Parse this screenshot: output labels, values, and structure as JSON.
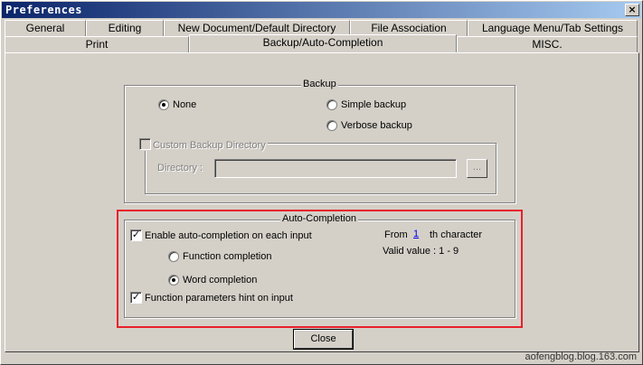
{
  "window": {
    "title": "Preferences"
  },
  "tabs_row1": [
    "General",
    "Editing",
    "New Document/Default Directory",
    "File Association",
    "Language Menu/Tab Settings"
  ],
  "tabs_row2": [
    "Print",
    "Backup/Auto-Completion",
    "MISC."
  ],
  "active_tab": "Backup/Auto-Completion",
  "backup": {
    "title": "Backup",
    "options": [
      {
        "label": "None",
        "selected": true
      },
      {
        "label": "Simple backup",
        "selected": false
      },
      {
        "label": "Verbose backup",
        "selected": false
      }
    ],
    "custom_dir": {
      "label": "Custom Backup Directory",
      "checked": false,
      "enabled": false,
      "directory_label": "Directory :",
      "directory_value": "",
      "browse_label": "..."
    }
  },
  "auto_completion": {
    "title": "Auto-Completion",
    "enable_label": "Enable auto-completion on each input",
    "enable_checked": true,
    "function_completion_label": "Function completion",
    "function_completion_selected": false,
    "word_completion_label": "Word completion",
    "word_completion_selected": true,
    "hint_label": "Function parameters hint on input",
    "hint_checked": true,
    "from_label": "From",
    "from_value": "1",
    "th_char_label": "th character",
    "valid_value_label": "Valid value : 1 - 9"
  },
  "buttons": {
    "close_label": "Close"
  },
  "watermark": "aofengblog.blog.163.com",
  "colors": {
    "highlight": "#e8202a",
    "title_bar_start": "#0a246a",
    "title_bar_end": "#a6caf0",
    "link": "#0000ee"
  }
}
